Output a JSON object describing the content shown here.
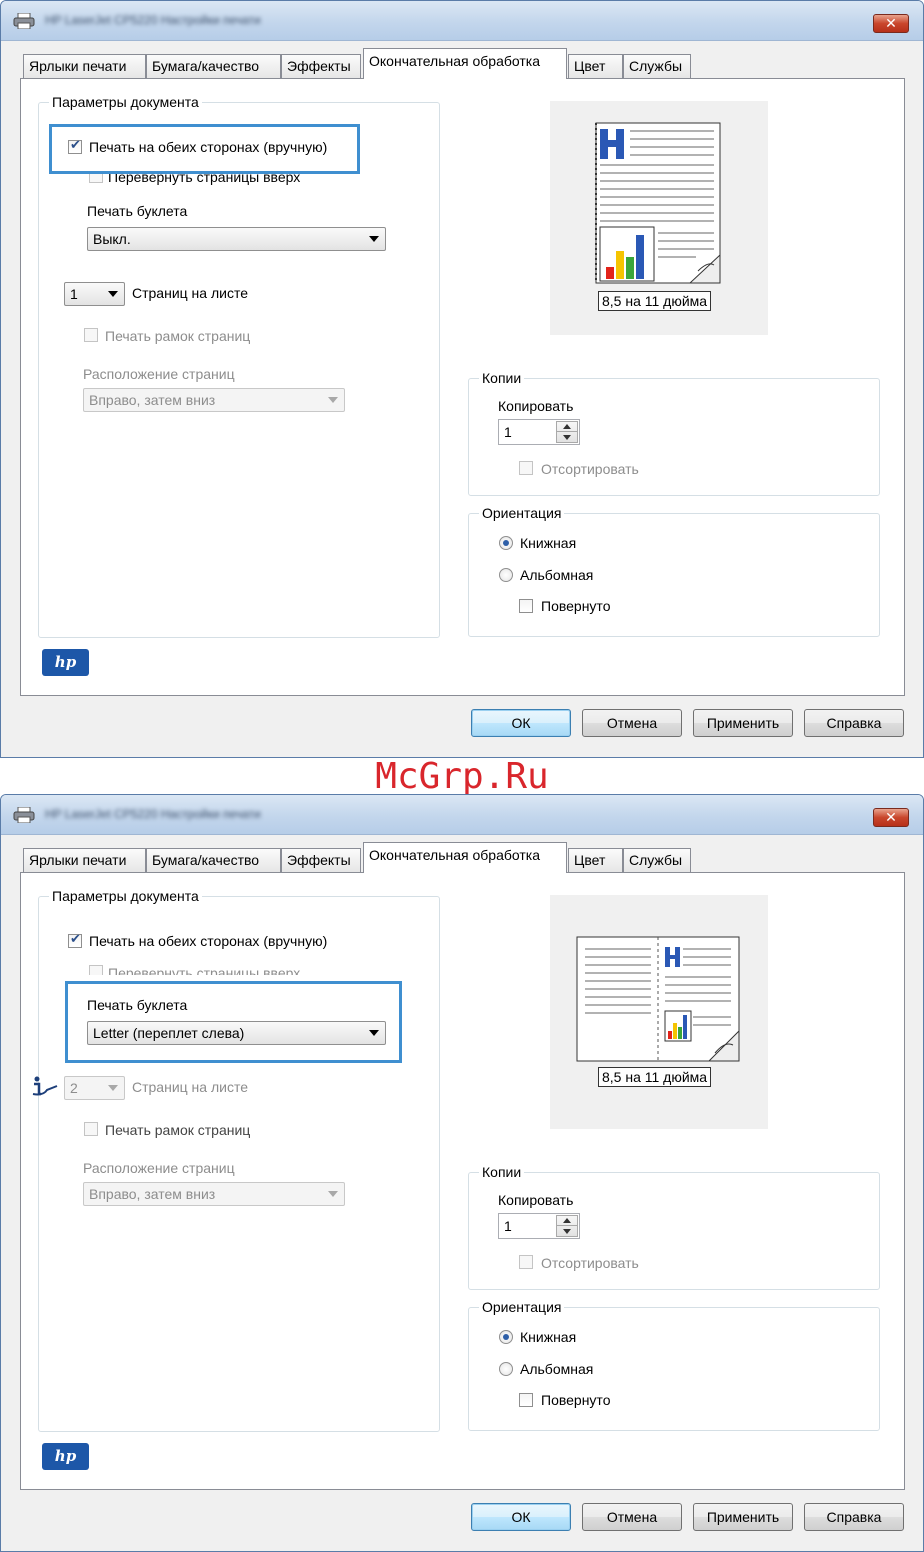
{
  "watermark": "McGrp.Ru",
  "colors": {
    "accent": "#3f8fd0",
    "close": "#c9462c",
    "hp": "#1d57a8",
    "watermark": "#d9262c"
  },
  "dialogs": [
    {
      "title": "HP LaserJet CP5220 Настройки печати",
      "close_icon": "close-icon",
      "tabs": [
        "Ярлыки печати",
        "Бумага/качество",
        "Эффекты",
        "Окончательная обработка",
        "Цвет",
        "Службы"
      ],
      "active_tab": "Окончательная обработка",
      "doc_options": {
        "title": "Параметры документа",
        "duplex": {
          "label": "Печать на обеих сторонах (вручную)",
          "checked": true
        },
        "flip": {
          "label": "Перевернуть страницы вверх",
          "checked": false
        },
        "booklet_label": "Печать буклета",
        "booklet_value": "Выкл.",
        "pages_per_sheet": {
          "value": "1",
          "label": "Страниц на листе"
        },
        "borders": {
          "label": "Печать рамок страниц",
          "checked": false
        },
        "order_label": "Расположение страниц",
        "order_value": "Вправо, затем вниз"
      },
      "preview_label": "8,5 на 11 дюйма",
      "copies": {
        "title": "Копии",
        "label": "Копировать",
        "value": "1",
        "collate": "Отсортировать"
      },
      "orientation": {
        "title": "Ориентация",
        "portrait": "Книжная",
        "landscape": "Альбомная",
        "rotated": "Повернуто",
        "selected": "Книжная"
      },
      "buttons": {
        "ok": "ОК",
        "cancel": "Отмена",
        "apply": "Применить",
        "help": "Справка"
      },
      "logo": "hp"
    },
    {
      "title": "HP LaserJet CP5220 Настройки печати",
      "close_icon": "close-icon",
      "tabs": [
        "Ярлыки печати",
        "Бумага/качество",
        "Эффекты",
        "Окончательная обработка",
        "Цвет",
        "Службы"
      ],
      "active_tab": "Окончательная обработка",
      "doc_options": {
        "title": "Параметры документа",
        "duplex": {
          "label": "Печать на обеих сторонах (вручную)",
          "checked": true
        },
        "flip": {
          "label": "Перевернуть страницы вверх",
          "checked": false
        },
        "booklet_label": "Печать буклета",
        "booklet_value": "Letter (переплет слева)",
        "pages_per_sheet": {
          "value": "2",
          "label": "Страниц на листе"
        },
        "borders": {
          "label": "Печать рамок страниц",
          "checked": false
        },
        "order_label": "Расположение страниц",
        "order_value": "Вправо, затем вниз"
      },
      "preview_label": "8,5 на 11 дюйма",
      "copies": {
        "title": "Копии",
        "label": "Копировать",
        "value": "1",
        "collate": "Отсортировать"
      },
      "orientation": {
        "title": "Ориентация",
        "portrait": "Книжная",
        "landscape": "Альбомная",
        "rotated": "Повернуто",
        "selected": "Книжная"
      },
      "buttons": {
        "ok": "ОК",
        "cancel": "Отмена",
        "apply": "Применить",
        "help": "Справка"
      },
      "logo": "hp"
    }
  ]
}
